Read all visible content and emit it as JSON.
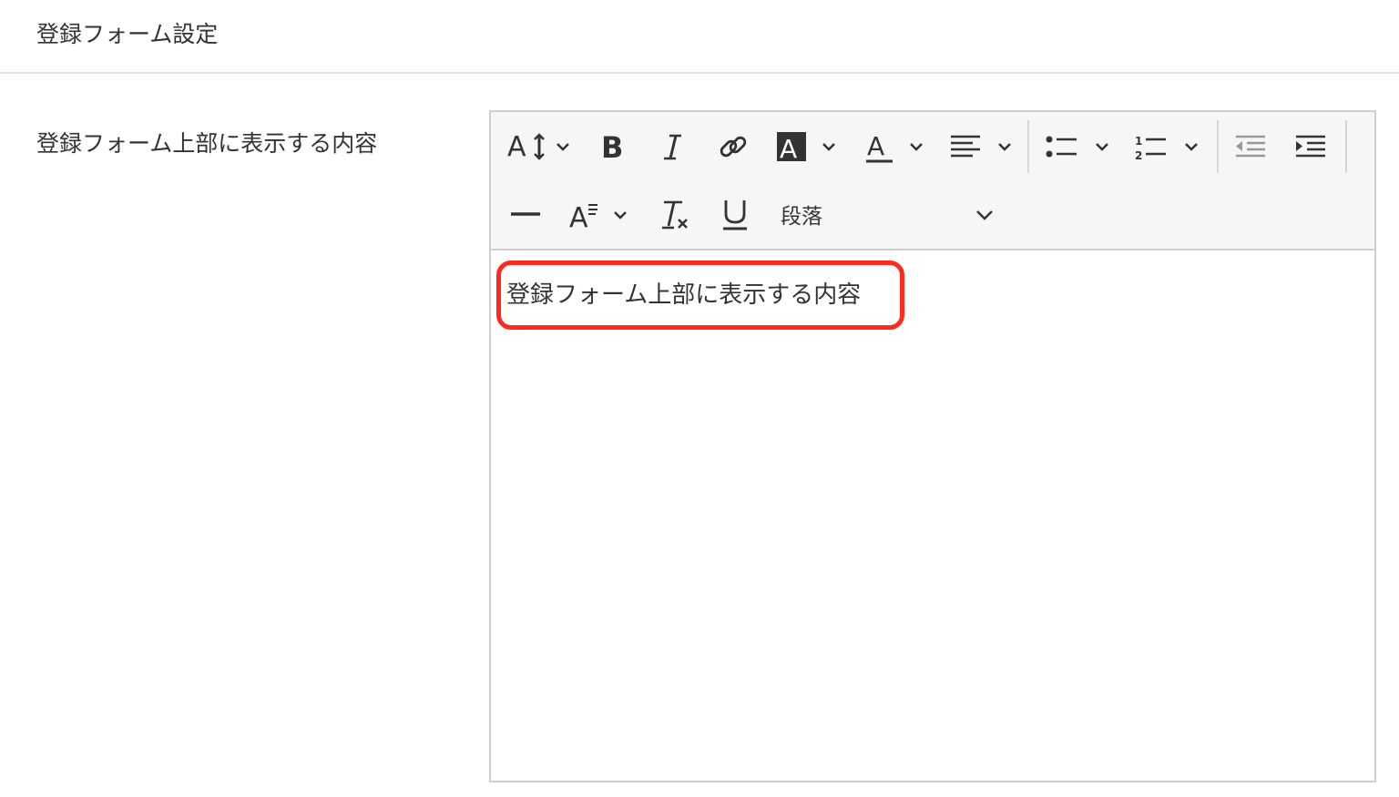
{
  "header": {
    "title": "登録フォーム設定"
  },
  "field": {
    "label": "登録フォーム上部に表示する内容"
  },
  "editor": {
    "toolbar": {
      "paragraph_style": "段落",
      "buttons": [
        "font-size-icon",
        "bold-icon",
        "italic-icon",
        "link-icon",
        "background-color-icon",
        "text-color-icon",
        "align-icon",
        "bulleted-list-icon",
        "numbered-list-icon",
        "outdent-icon",
        "indent-icon",
        "horizontal-line-icon",
        "font-family-icon",
        "clear-format-icon",
        "underline-icon"
      ]
    },
    "content": "登録フォーム上部に表示する内容"
  },
  "colors": {
    "highlight": "#ff2a1f",
    "toolbar_background": "#f6f6f6",
    "border": "#cfcfcf",
    "text": "#333333"
  }
}
